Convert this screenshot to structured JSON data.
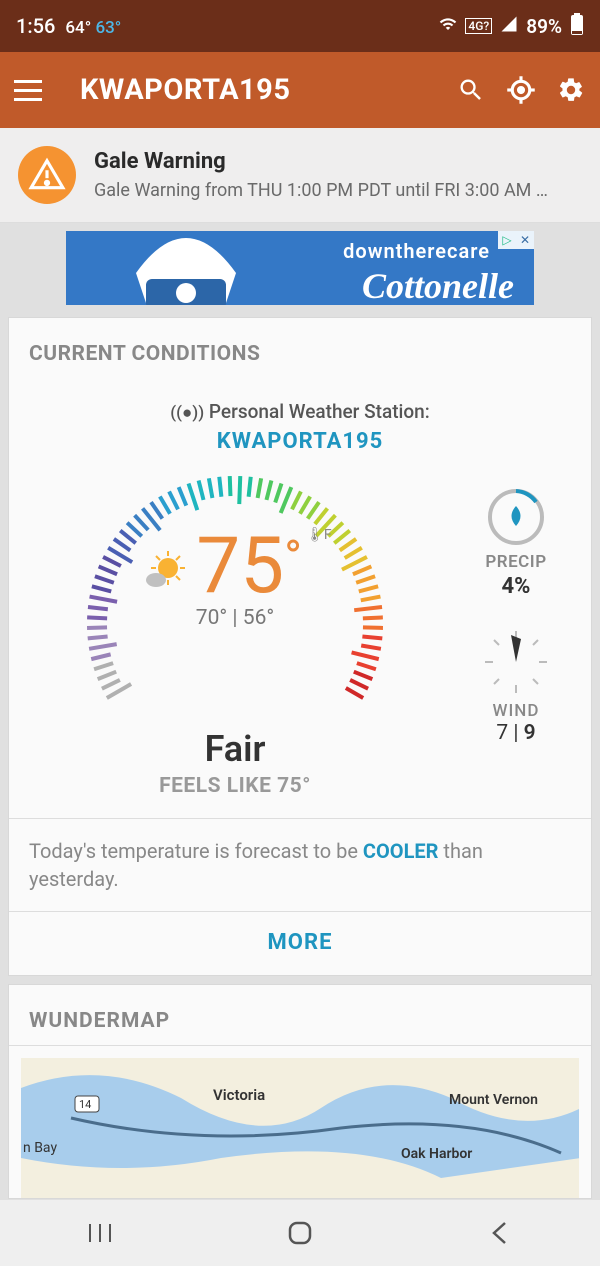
{
  "status": {
    "time": "1:56",
    "temp1": "64°",
    "temp2": "63°",
    "network": "4G?",
    "battery": "89%"
  },
  "appbar": {
    "title": "KWAPORTA195"
  },
  "alert": {
    "title": "Gale Warning",
    "subtitle": "Gale Warning from THU 1:00 PM PDT until FRI 3:00 AM P…"
  },
  "ad": {
    "line1": "downtherecare",
    "line2": "Cottonelle"
  },
  "conditions": {
    "heading": "CURRENT CONDITIONS",
    "pws_label": "Personal Weather Station:",
    "pws_name": "KWAPORTA195",
    "temp": "75",
    "unit": "F",
    "high": "70°",
    "low": "56°",
    "sky": "Fair",
    "feels_prefix": "FEELS LIKE ",
    "feels_val": "75°",
    "precip_label": "PRECIP",
    "precip_val": "4%",
    "wind_label": "WIND",
    "wind_speed": "7",
    "wind_gust": "9",
    "forecast_pre": "Today's temperature is forecast to be ",
    "forecast_hl": "COOLER",
    "forecast_post": " than yesterday.",
    "more": "MORE"
  },
  "wundermap": {
    "heading": "WUNDERMAP",
    "labels": {
      "victoria": "Victoria",
      "mtvernon": "Mount Vernon",
      "oakharbor": "Oak Harbor",
      "bay": "n Bay",
      "hwy": "14"
    }
  }
}
